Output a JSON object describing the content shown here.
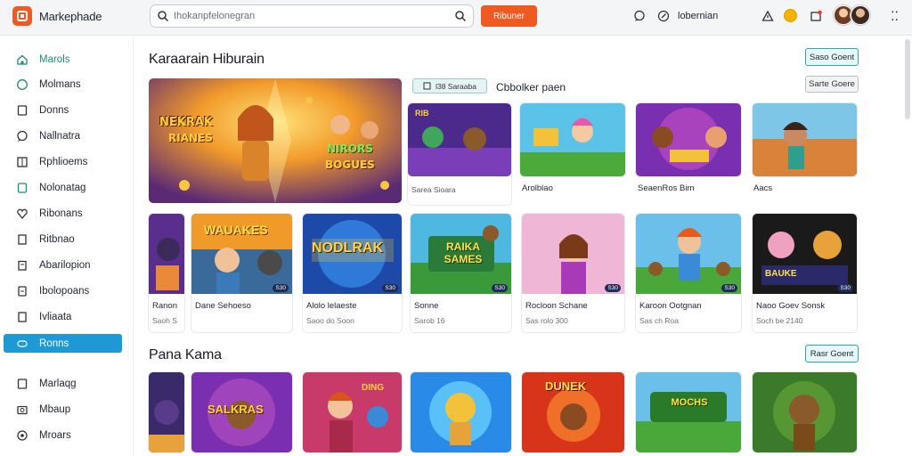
{
  "header": {
    "app_title": "Markephade",
    "search_placeholder": "Ihokanpfelonegran",
    "cta_label": "Ribuner",
    "user_label": "lobernian"
  },
  "sidebar": {
    "items": [
      {
        "label": "Marols",
        "icon": "home-icon"
      },
      {
        "label": "Molmans",
        "icon": "circle-info-icon"
      },
      {
        "label": "Donns",
        "icon": "square-icon"
      },
      {
        "label": "Nallnatra",
        "icon": "chat-icon"
      },
      {
        "label": "Rphlioems",
        "icon": "grid-icon"
      },
      {
        "label": "Nolonatag",
        "icon": "tag-icon"
      },
      {
        "label": "Ribonans",
        "icon": "heart-icon"
      },
      {
        "label": "Ritbnao",
        "icon": "document-icon"
      },
      {
        "label": "Abarilopion",
        "icon": "clipboard-icon"
      },
      {
        "label": "Ibolopoans",
        "icon": "flag-icon"
      },
      {
        "label": "Ivliaata",
        "icon": "file-icon"
      },
      {
        "label": "Ronns",
        "icon": "controller-icon"
      },
      {
        "label": "Marlaqg",
        "icon": "inbox-icon"
      },
      {
        "label": "Mbaup",
        "icon": "camera-icon"
      },
      {
        "label": "Mroars",
        "icon": "settings-icon"
      }
    ],
    "active_index": 11
  },
  "section1": {
    "title": "Karaarain Hiburain",
    "button_primary": "Saso Goent",
    "button_secondary": "Sarte Goere",
    "chip": "l38 Saraaba",
    "sublabel": "Cbbolker paen",
    "hero_text_1": "NEKRAK",
    "hero_text_2": "RIANES",
    "hero_text_3": "NIRORS",
    "hero_text_4": "BOGUES",
    "top_row": [
      {
        "caption": "Sarea Sioara",
        "thumb_title": "RIB"
      },
      {
        "caption": "Arolblao"
      },
      {
        "caption": "SeaenRos Bim"
      },
      {
        "caption": "Aacs"
      }
    ],
    "grid_row": [
      {
        "title": "Ranon",
        "meta": "Saoh S",
        "thumb_title": "",
        "badge": ""
      },
      {
        "title": "Dane Sehoeso",
        "meta": "",
        "thumb_title": "WAUAKES",
        "badge": "S30"
      },
      {
        "title": "Alolo lelaeste",
        "meta": "Saoo do Soon",
        "thumb_title": "NODLRAK",
        "badge": "S30"
      },
      {
        "title": "Sonne",
        "meta": "Sarob 16",
        "thumb_title": "RAIKA SAMES",
        "badge": "S30"
      },
      {
        "title": "Rocloon Schane",
        "meta": "Sas rolo 300",
        "thumb_title": "",
        "badge": "S30"
      },
      {
        "title": "Karoon Ootgnan",
        "meta": "Sas ch Roa",
        "thumb_title": "",
        "badge": "S30"
      },
      {
        "title": "Naoo Goev Sonsk",
        "meta": "Soch be 2140",
        "thumb_title": "BAUKE",
        "badge": "S30"
      }
    ]
  },
  "section2": {
    "title": "Pana Kama",
    "button": "Rasr Goent",
    "cards": [
      {
        "thumb_title": ""
      },
      {
        "thumb_title": "SALKRAS"
      },
      {
        "thumb_title": "DING"
      },
      {
        "thumb_title": ""
      },
      {
        "thumb_title": "DUNEK"
      },
      {
        "thumb_title": "MOCHS"
      },
      {
        "thumb_title": ""
      }
    ]
  },
  "colors": {
    "accent": "#ef5a23",
    "sidebar_active": "#1d9ad6",
    "teal_outline": "#2aa7b8"
  }
}
